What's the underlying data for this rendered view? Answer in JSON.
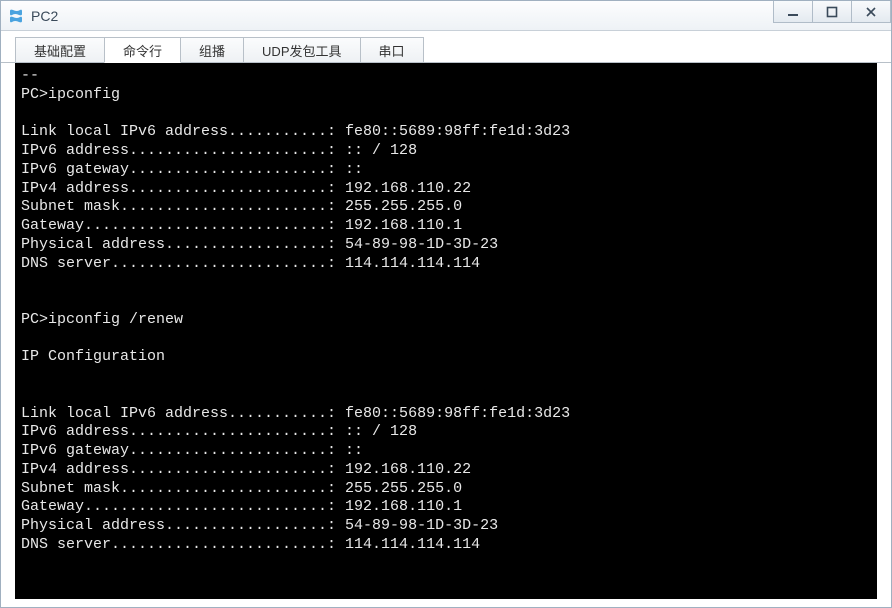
{
  "window": {
    "title": "PC2"
  },
  "tabs": [
    {
      "label": "基础配置"
    },
    {
      "label": "命令行"
    },
    {
      "label": "组播"
    },
    {
      "label": "UDP发包工具"
    },
    {
      "label": "串口"
    }
  ],
  "terminal": {
    "lines": [
      "--",
      "PC>ipconfig",
      "",
      "Link local IPv6 address...........: fe80::5689:98ff:fe1d:3d23",
      "IPv6 address......................: :: / 128",
      "IPv6 gateway......................: ::",
      "IPv4 address......................: 192.168.110.22",
      "Subnet mask.......................: 255.255.255.0",
      "Gateway...........................: 192.168.110.1",
      "Physical address..................: 54-89-98-1D-3D-23",
      "DNS server........................: 114.114.114.114",
      "",
      "",
      "PC>ipconfig /renew",
      "",
      "IP Configuration",
      "",
      "",
      "Link local IPv6 address...........: fe80::5689:98ff:fe1d:3d23",
      "IPv6 address......................: :: / 128",
      "IPv6 gateway......................: ::",
      "IPv4 address......................: 192.168.110.22",
      "Subnet mask.......................: 255.255.255.0",
      "Gateway...........................: 192.168.110.1",
      "Physical address..................: 54-89-98-1D-3D-23",
      "DNS server........................: 114.114.114.114",
      ""
    ]
  }
}
